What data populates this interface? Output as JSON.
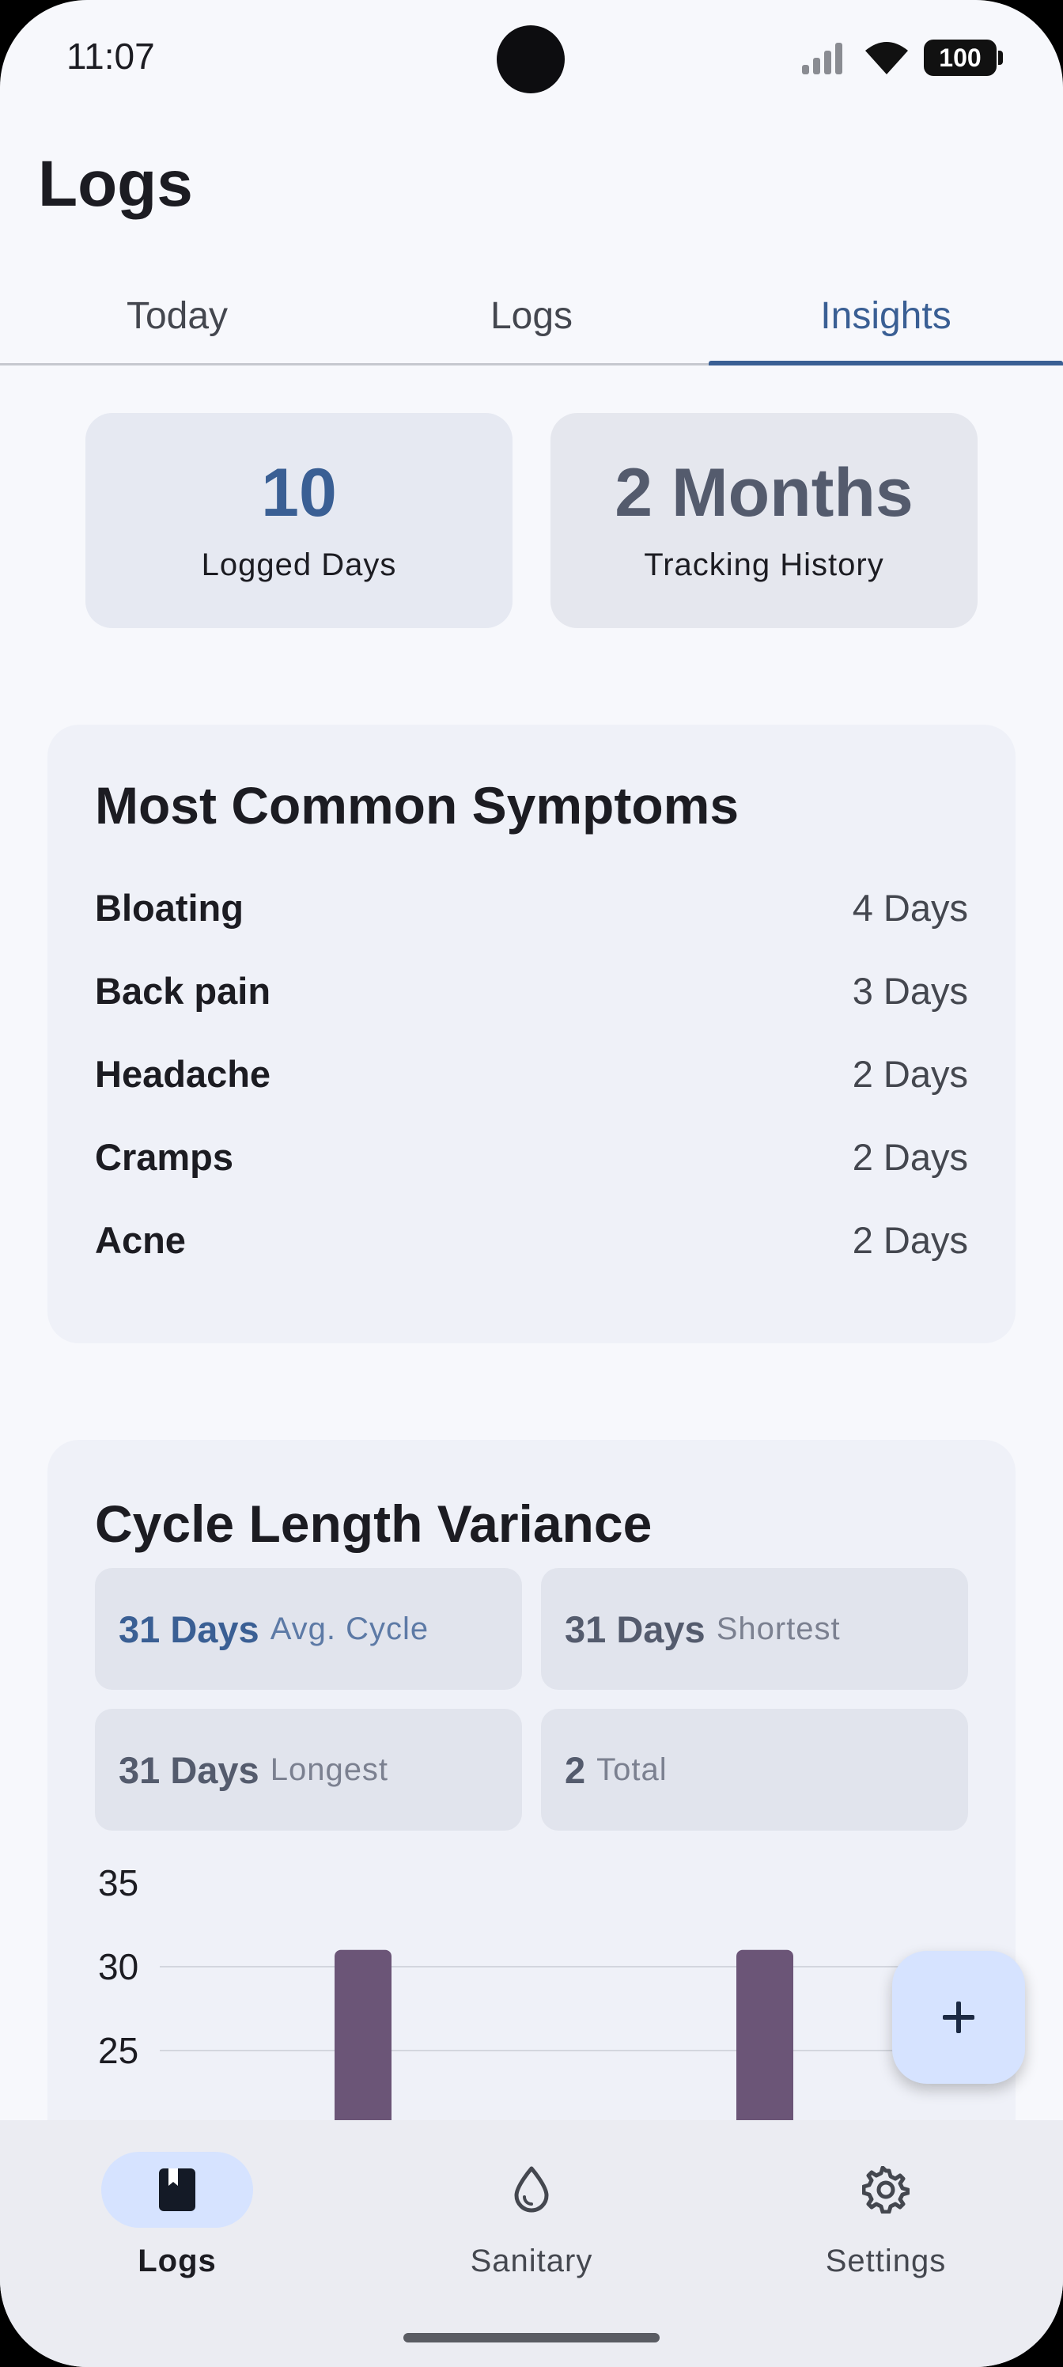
{
  "status_bar": {
    "time": "11:07",
    "battery": "100"
  },
  "page_title": "Logs",
  "tabs": [
    {
      "label": "Today",
      "active": false
    },
    {
      "label": "Logs",
      "active": false
    },
    {
      "label": "Insights",
      "active": true
    }
  ],
  "summary": {
    "logged_days": {
      "value": "10",
      "label": "Logged Days"
    },
    "tracking_history": {
      "value": "2 Months",
      "label": "Tracking History"
    }
  },
  "symptoms": {
    "title": "Most Common Symptoms",
    "items": [
      {
        "name": "Bloating",
        "days": "4 Days"
      },
      {
        "name": "Back pain",
        "days": "3 Days"
      },
      {
        "name": "Headache",
        "days": "2 Days"
      },
      {
        "name": "Cramps",
        "days": "2 Days"
      },
      {
        "name": "Acne",
        "days": "2 Days"
      }
    ]
  },
  "cycle": {
    "title": "Cycle Length Variance",
    "avg": {
      "value": "31 Days",
      "label": "Avg. Cycle"
    },
    "shortest": {
      "value": "31 Days",
      "label": "Shortest"
    },
    "longest": {
      "value": "31 Days",
      "label": "Longest"
    },
    "total": {
      "value": "2",
      "label": "Total"
    }
  },
  "chart_data": {
    "type": "bar",
    "categories": [
      "",
      ""
    ],
    "values": [
      31,
      31
    ],
    "y_ticks": [
      "35",
      "30",
      "25"
    ],
    "title": "",
    "xlabel": "",
    "ylabel": "",
    "grid": true,
    "bar_color": "#6b5577"
  },
  "colors": {
    "accent": "#3a5f94",
    "fab": "#d6e3ff",
    "bar": "#6b5577"
  },
  "fab": {
    "icon": "plus-icon",
    "symbol": "+"
  },
  "bottom_nav": [
    {
      "label": "Logs",
      "icon": "book-icon",
      "active": true
    },
    {
      "label": "Sanitary",
      "icon": "droplet-icon",
      "active": false
    },
    {
      "label": "Settings",
      "icon": "gear-icon",
      "active": false
    }
  ]
}
